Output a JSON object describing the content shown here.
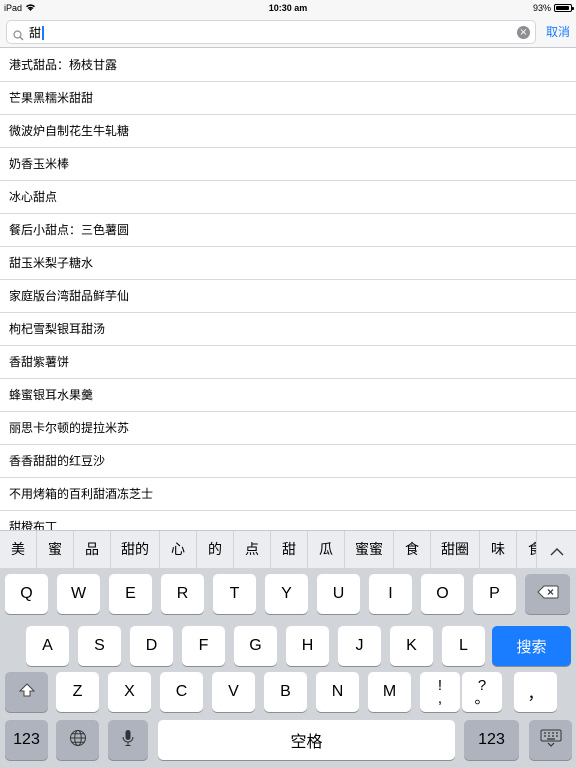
{
  "status_bar": {
    "device": "iPad",
    "time": "10:30 am",
    "battery": "93%",
    "battery_level": 0.93
  },
  "search": {
    "query": "甜",
    "cancel_label": "取消"
  },
  "results": [
    "港式甜品：杨枝甘露",
    "芒果黑糯米甜甜",
    "微波炉自制花生牛轧糖",
    "奶香玉米棒",
    "冰心甜点",
    "餐后小甜点：三色薯圆",
    "甜玉米梨子糖水",
    "家庭版台湾甜品鲜芋仙",
    "枸杞雪梨银耳甜汤",
    "香甜紫薯饼",
    "蜂蜜银耳水果羹",
    "丽思卡尔顿的提拉米苏",
    "香香甜甜的红豆沙",
    "不用烤箱的百利甜酒冻芝士",
    "甜橙布丁"
  ],
  "candidates": [
    "美",
    "蜜",
    "品",
    "甜的",
    "心",
    "的",
    "点",
    "甜",
    "瓜",
    "蜜蜜",
    "食",
    "甜圈",
    "味",
    "食"
  ],
  "keyboard": {
    "row1": [
      "Q",
      "W",
      "E",
      "R",
      "T",
      "Y",
      "U",
      "I",
      "O",
      "P"
    ],
    "row2": [
      "A",
      "S",
      "D",
      "F",
      "G",
      "H",
      "J",
      "K",
      "L"
    ],
    "row3": [
      "Z",
      "X",
      "C",
      "V",
      "B",
      "N",
      "M"
    ],
    "punct1": {
      "top": "!",
      "bottom": ","
    },
    "punct2": {
      "top": "?",
      "bottom": "。"
    },
    "comma": "，",
    "search_label": "搜索",
    "numbers_label": "123",
    "space_label": "空格"
  },
  "colors": {
    "accent": "#1a7cff",
    "keyboard_bg": "#d1d4d9",
    "special_key": "#aeb3be"
  }
}
